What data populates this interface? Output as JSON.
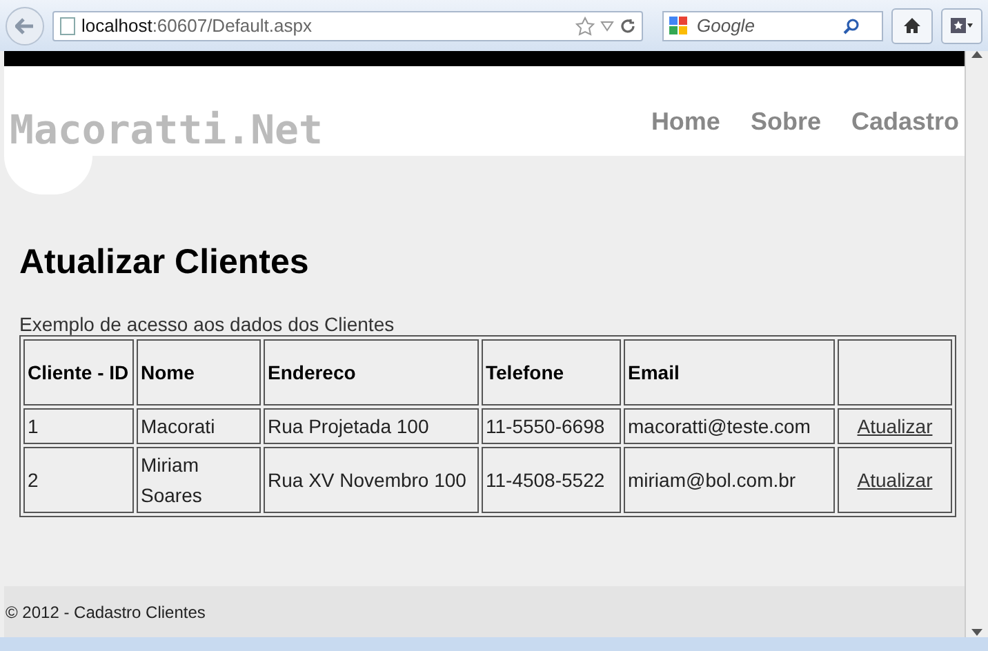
{
  "browser": {
    "address_host": "localhost",
    "address_rest": ":60607/Default.aspx",
    "search_placeholder": "Google"
  },
  "header": {
    "logo": "Macoratti.Net",
    "nav": [
      "Home",
      "Sobre",
      "Cadastro"
    ]
  },
  "page": {
    "title": "Atualizar Clientes",
    "caption": "Exemplo de acesso aos dados dos Clientes"
  },
  "table": {
    "columns": [
      "Cliente - ID",
      "Nome",
      "Endereco",
      "Telefone",
      "Email"
    ],
    "rows": [
      {
        "cells": [
          "1",
          "Macorati",
          "Rua Projetada 100",
          "11-5550-6698",
          "macoratti@teste.com"
        ],
        "action": "Atualizar"
      },
      {
        "cells": [
          "2",
          "Miriam Soares",
          "Rua XV Novembro 100",
          "11-4508-5522",
          "miriam@bol.com.br"
        ],
        "action": "Atualizar"
      }
    ]
  },
  "footer": {
    "text": "© 2012 - Cadastro Clientes"
  }
}
